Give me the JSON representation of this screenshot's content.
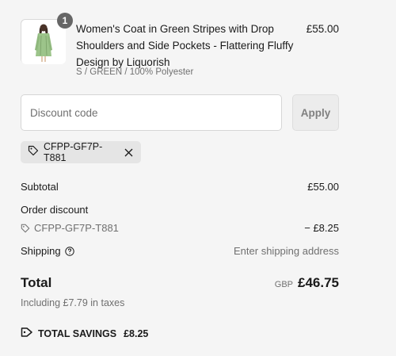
{
  "product": {
    "quantity": "1",
    "title": "Women's Coat in Green Stripes with Drop Shoulders and Side Pockets - Flattering Fluffy Design by Liquorish",
    "variant": "S / GREEN / 100% Polyester",
    "price": "£55.00"
  },
  "discount": {
    "placeholder": "Discount code",
    "value": "",
    "apply_label": "Apply",
    "applied_code": "CFPP-GF7P-T881"
  },
  "summary": {
    "subtotal_label": "Subtotal",
    "subtotal_value": "£55.00",
    "order_discount_label": "Order discount",
    "discount_code": "CFPP-GF7P-T881",
    "discount_value": "− £8.25",
    "shipping_label": "Shipping",
    "shipping_value": "Enter shipping address",
    "total_label": "Total",
    "currency": "GBP",
    "total_value": "£46.75",
    "taxes_text": "Including £7.79 in taxes",
    "savings_label": "TOTAL SAVINGS",
    "savings_value": "£8.25"
  },
  "icons": {
    "tag": "tag-icon",
    "close": "close-icon",
    "help": "help-icon",
    "savings": "tag-icon"
  },
  "colors": {
    "background": "#f5f5f5",
    "badge": "#666666",
    "muted_text": "#707070",
    "tag_background": "#e5e5e5",
    "coat": "#9cc48a"
  }
}
